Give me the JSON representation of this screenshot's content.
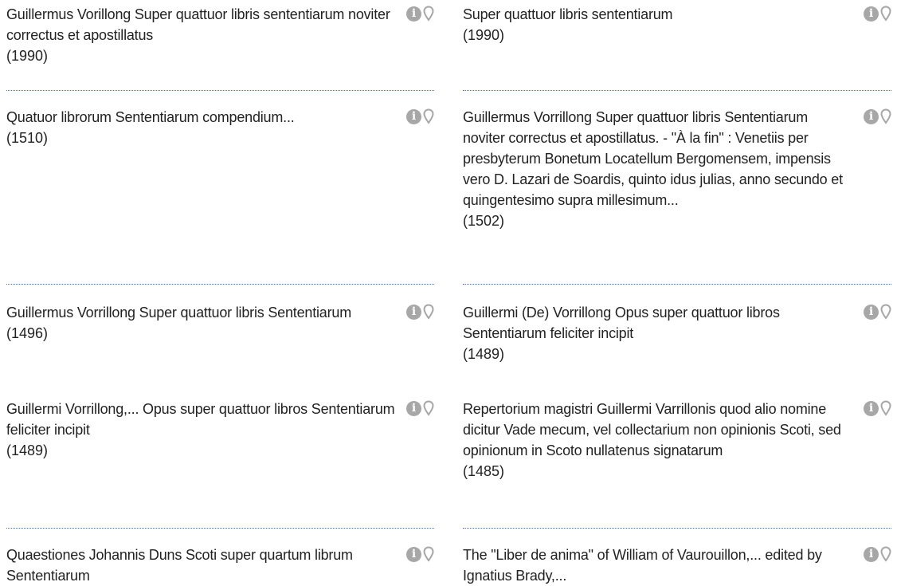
{
  "results": {
    "left": [
      {
        "title": "Guillermus Vorillong Super quattuor libris sententiarum noviter correctus et apostillatus",
        "year": "(1990)"
      },
      {
        "title": "Quatuor librorum Sententiarum compendium...",
        "year": "(1510)"
      },
      {
        "title": "Guillermus Vorrillong Super quattuor libris Sententiarum",
        "year": "(1496)"
      },
      {
        "title": "Guillermi Vorrillong,... Opus super quattuor libros Sententiarum feliciter incipit",
        "year": "(1489)"
      },
      {
        "title": "Quaestiones Johannis Duns Scoti super quartum librum Sententiarum",
        "year": ""
      }
    ],
    "right": [
      {
        "title": "Super quattuor libris sententiarum",
        "year": "(1990)"
      },
      {
        "title": "Guillermus Vorrillong Super quattuor libris Sententiarum noviter correctus et apostillatus. - \"À la fin\" : Venetiis per presbyterum Bonetum Locatellum Bergomensem, impensis vero D. Lazari de Soardis, quinto idus julias, anno secundo et quingentesimo supra millesimum...",
        "year": "(1502)"
      },
      {
        "title": "Guillermi (De) Vorrillong Opus super quattuor libros Sententiarum feliciter incipit",
        "year": "(1489)"
      },
      {
        "title": "Repertorium magistri Guillermi Varrillonis quod alio nomine dicitur Vade mecum, vel collectarium non opinionis Scoti, sed opinionum in Scoto nullatenus signatarum",
        "year": "(1485)"
      },
      {
        "title": "The \"Liber de anima\" of William of Vaurouillon,... edited by Ignatius Brady,...",
        "year": ""
      }
    ]
  },
  "icons": {
    "info": "info-icon",
    "pin": "map-pin-icon",
    "info_glyph": "i"
  },
  "colors": {
    "text": "#222222",
    "icon": "#a7a7a7",
    "separator": "#4a78b3",
    "background": "#ffffff"
  }
}
